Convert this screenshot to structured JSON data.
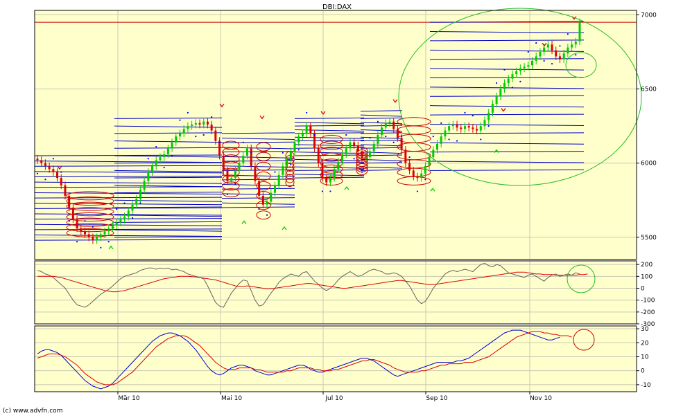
{
  "title": "DBI:DAX",
  "copyright": "(c) www.advfn.com",
  "colors": {
    "background": "#ffffcc",
    "grid": "#c8c8b4",
    "up_candle": "#00cc00",
    "down_candle": "#dd0000",
    "regression": "#0000cc",
    "ellipse_red": "#cc0000",
    "ellipse_green": "#22bb22",
    "hline": "#cc0000",
    "dots": "#0000ff"
  },
  "x_labels": [
    "Mär 10",
    "Mai 10",
    "Jul 10",
    "Sep 10",
    "Nov 10"
  ],
  "chart_data": [
    {
      "type": "candlestick",
      "name": "price",
      "ylim": [
        5350,
        7030
      ],
      "y_ticks": [
        5500,
        6000,
        6500,
        7000
      ],
      "grid": true,
      "resistance_line": 6950,
      "close": [
        6020,
        6000,
        5980,
        5960,
        5940,
        5900,
        5850,
        5780,
        5700,
        5620,
        5560,
        5540,
        5520,
        5500,
        5480,
        5500,
        5520,
        5540,
        5560,
        5580,
        5600,
        5620,
        5640,
        5680,
        5720,
        5760,
        5820,
        5880,
        5940,
        5980,
        6020,
        6040,
        6060,
        6100,
        6140,
        6180,
        6200,
        6230,
        6250,
        6260,
        6270,
        6260,
        6280,
        6260,
        6220,
        6150,
        6050,
        5950,
        5880,
        5900,
        5950,
        6000,
        6050,
        6100,
        5980,
        5880,
        5780,
        5720,
        5740,
        5800,
        5850,
        5920,
        5980,
        6020,
        6080,
        6140,
        6180,
        6200,
        6250,
        6200,
        6100,
        6000,
        5900,
        5870,
        5900,
        5960,
        6010,
        6060,
        6100,
        6140,
        6120,
        6080,
        6030,
        6040,
        6080,
        6130,
        6190,
        6240,
        6270,
        6280,
        6230,
        6170,
        6090,
        6000,
        5950,
        5910,
        5900,
        5930,
        5980,
        6040,
        6090,
        6130,
        6180,
        6220,
        6250,
        6260,
        6240,
        6230,
        6250,
        6240,
        6230,
        6220,
        6250,
        6290,
        6340,
        6400,
        6450,
        6500,
        6540,
        6570,
        6600,
        6620,
        6640,
        6650,
        6660,
        6690,
        6720,
        6750,
        6780,
        6800,
        6760,
        6720,
        6700,
        6740,
        6780,
        6800,
        6820,
        6950
      ]
    },
    {
      "type": "line",
      "name": "oscillator",
      "ylim": [
        -300,
        230
      ],
      "y_ticks": [
        -300,
        -200,
        -100,
        0,
        100,
        200
      ],
      "series": [
        {
          "name": "momentum",
          "color": "#606060",
          "values": [
            150,
            140,
            120,
            110,
            90,
            60,
            30,
            0,
            -50,
            -100,
            -140,
            -150,
            -160,
            -140,
            -110,
            -80,
            -50,
            -30,
            -10,
            20,
            50,
            80,
            100,
            110,
            120,
            130,
            150,
            160,
            170,
            170,
            160,
            170,
            165,
            170,
            155,
            160,
            150,
            140,
            120,
            110,
            100,
            90,
            80,
            20,
            -50,
            -120,
            -150,
            -160,
            -100,
            -40,
            0,
            40,
            70,
            60,
            -20,
            -100,
            -150,
            -140,
            -90,
            -40,
            0,
            50,
            80,
            100,
            120,
            110,
            100,
            130,
            140,
            100,
            60,
            30,
            0,
            -20,
            0,
            30,
            70,
            100,
            120,
            140,
            120,
            100,
            110,
            130,
            150,
            160,
            150,
            140,
            120,
            120,
            130,
            120,
            100,
            60,
            20,
            -40,
            -100,
            -130,
            -110,
            -60,
            0,
            40,
            80,
            120,
            140,
            150,
            140,
            150,
            160,
            150,
            140,
            170,
            200,
            210,
            190,
            180,
            200,
            190,
            160,
            130,
            120,
            110,
            100,
            90,
            110,
            120,
            100,
            80,
            60,
            90,
            110,
            120,
            100,
            110,
            120,
            110,
            130,
            120
          ]
        },
        {
          "name": "average",
          "color": "#dd0000",
          "values": [
            100,
            100,
            100,
            100,
            100,
            95,
            90,
            80,
            70,
            60,
            50,
            40,
            30,
            20,
            10,
            0,
            -10,
            -20,
            -25,
            -30,
            -30,
            -25,
            -20,
            -10,
            0,
            10,
            20,
            30,
            40,
            50,
            60,
            70,
            80,
            85,
            90,
            95,
            100,
            100,
            100,
            98,
            95,
            90,
            85,
            80,
            75,
            70,
            60,
            50,
            40,
            30,
            20,
            15,
            15,
            20,
            15,
            10,
            5,
            0,
            -5,
            -5,
            0,
            5,
            10,
            15,
            20,
            25,
            30,
            35,
            40,
            40,
            35,
            30,
            25,
            20,
            15,
            10,
            5,
            0,
            0,
            5,
            10,
            15,
            20,
            25,
            30,
            35,
            40,
            45,
            50,
            55,
            60,
            65,
            65,
            60,
            55,
            50,
            45,
            40,
            35,
            30,
            30,
            35,
            40,
            45,
            50,
            55,
            60,
            65,
            70,
            75,
            80,
            85,
            90,
            95,
            100,
            105,
            110,
            115,
            120,
            125,
            130,
            135,
            135,
            135,
            130,
            125,
            120,
            120,
            115,
            115,
            115,
            110,
            110,
            110,
            110,
            110,
            110,
            115,
            115,
            120
          ]
        }
      ]
    },
    {
      "type": "line",
      "name": "macd",
      "ylim": [
        -15,
        32
      ],
      "y_ticks": [
        -10,
        0,
        10,
        20,
        30
      ],
      "series": [
        {
          "name": "macd",
          "color": "#0000cc",
          "values": [
            12,
            14,
            15,
            15,
            14,
            13,
            11,
            8,
            5,
            2,
            -1,
            -4,
            -7,
            -9,
            -11,
            -12,
            -13,
            -12,
            -11,
            -9,
            -6,
            -3,
            0,
            3,
            6,
            9,
            12,
            15,
            18,
            21,
            23,
            25,
            26,
            27,
            27,
            26,
            25,
            23,
            21,
            18,
            15,
            11,
            7,
            3,
            0,
            -2,
            -3,
            -2,
            0,
            2,
            3,
            4,
            4,
            3,
            2,
            0,
            -1,
            -2,
            -3,
            -3,
            -2,
            -1,
            0,
            1,
            2,
            3,
            4,
            4,
            3,
            1,
            0,
            -1,
            -1,
            0,
            1,
            2,
            3,
            4,
            5,
            6,
            7,
            8,
            9,
            9,
            8,
            7,
            5,
            3,
            1,
            -1,
            -3,
            -4,
            -3,
            -2,
            -1,
            0,
            1,
            2,
            3,
            4,
            5,
            6,
            6,
            6,
            6,
            6,
            7,
            7,
            8,
            9,
            11,
            13,
            15,
            17,
            19,
            21,
            23,
            25,
            27,
            28,
            29,
            29,
            29,
            28,
            27,
            26,
            25,
            24,
            23,
            22,
            22,
            23,
            24
          ]
        },
        {
          "name": "signal",
          "color": "#dd0000",
          "values": [
            9,
            10,
            11,
            12,
            12,
            12,
            11,
            10,
            8,
            6,
            4,
            1,
            -2,
            -4,
            -6,
            -8,
            -9,
            -10,
            -10,
            -10,
            -9,
            -7,
            -5,
            -3,
            -1,
            2,
            5,
            8,
            11,
            14,
            17,
            19,
            21,
            23,
            24,
            25,
            25,
            25,
            24,
            22,
            20,
            18,
            15,
            12,
            9,
            6,
            4,
            2,
            1,
            1,
            1,
            2,
            2,
            2,
            2,
            1,
            1,
            0,
            -1,
            -1,
            -1,
            -1,
            -1,
            0,
            0,
            1,
            2,
            2,
            2,
            2,
            1,
            1,
            0,
            0,
            0,
            1,
            1,
            2,
            3,
            4,
            5,
            6,
            7,
            7,
            8,
            8,
            7,
            6,
            5,
            4,
            2,
            1,
            0,
            -1,
            -1,
            -1,
            -1,
            0,
            0,
            1,
            2,
            3,
            4,
            4,
            5,
            5,
            5,
            5,
            6,
            6,
            6,
            7,
            8,
            9,
            10,
            12,
            14,
            16,
            18,
            20,
            22,
            24,
            25,
            26,
            27,
            28,
            28,
            28,
            27,
            27,
            26,
            26,
            25,
            25,
            25,
            24
          ]
        }
      ]
    }
  ]
}
